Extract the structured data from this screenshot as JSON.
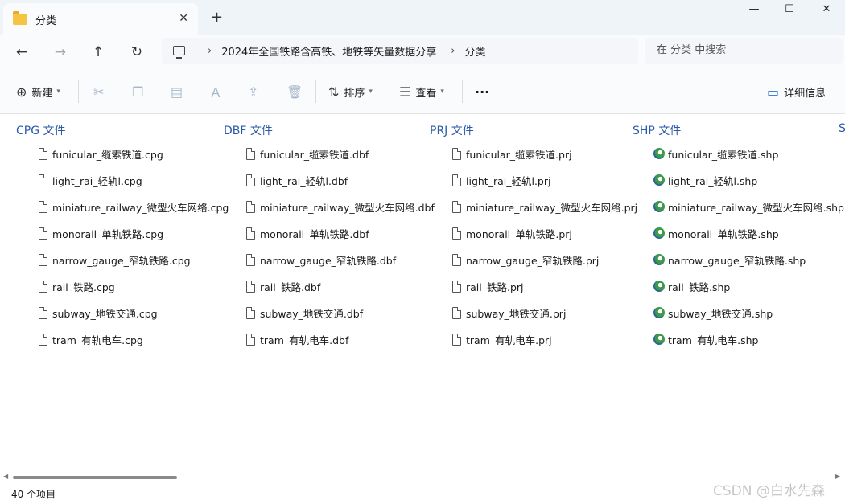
{
  "window": {
    "tab_title": "分类",
    "tab_close": "✕",
    "new_tab": "+",
    "minimize": "—",
    "maximize": "☐",
    "close": "✕"
  },
  "nav": {
    "back": "←",
    "forward": "→",
    "up": "↑",
    "refresh": "↻",
    "breadcrumb": [
      "2024年全国铁路含高铁、地铁等矢量数据分享",
      "分类"
    ],
    "search_placeholder": "在 分类 中搜索"
  },
  "toolbar": {
    "new_label": "新建",
    "sort_label": "排序",
    "view_label": "查看",
    "more_label": "···",
    "details_label": "详细信息"
  },
  "groups": [
    {
      "header": "CPG 文件",
      "icon": "file-icon",
      "files": [
        "funicular_缆索铁道.cpg",
        "light_rai_轻轨l.cpg",
        "miniature_railway_微型火车网络.cpg",
        "monorail_单轨铁路.cpg",
        "narrow_gauge_窄轨铁路.cpg",
        "rail_铁路.cpg",
        "subway_地铁交通.cpg",
        "tram_有轨电车.cpg"
      ]
    },
    {
      "header": "DBF 文件",
      "icon": "file-icon",
      "files": [
        "funicular_缆索铁道.dbf",
        "light_rai_轻轨l.dbf",
        "miniature_railway_微型火车网络.dbf",
        "monorail_单轨铁路.dbf",
        "narrow_gauge_窄轨铁路.dbf",
        "rail_铁路.dbf",
        "subway_地铁交通.dbf",
        "tram_有轨电车.dbf"
      ]
    },
    {
      "header": "PRJ 文件",
      "icon": "file-icon",
      "files": [
        "funicular_缆索铁道.prj",
        "light_rai_轻轨l.prj",
        "miniature_railway_微型火车网络.prj",
        "monorail_单轨铁路.prj",
        "narrow_gauge_窄轨铁路.prj",
        "rail_铁路.prj",
        "subway_地铁交通.prj",
        "tram_有轨电车.prj"
      ]
    },
    {
      "header": "SHP 文件",
      "icon": "shapefile-icon",
      "files": [
        "funicular_缆索铁道.shp",
        "light_rai_轻轨l.shp",
        "miniature_railway_微型火车网络.shp",
        "monorail_单轨铁路.shp",
        "narrow_gauge_窄轨铁路.shp",
        "rail_铁路.shp",
        "subway_地铁交通.shp",
        "tram_有轨电车.shp"
      ]
    }
  ],
  "partial_group_letter": "S",
  "status": {
    "item_count": "40 个项目"
  },
  "watermark": "CSDN @白水先森",
  "colors": {
    "group_header": "#2b5aa8",
    "folder": "#f6c443"
  }
}
